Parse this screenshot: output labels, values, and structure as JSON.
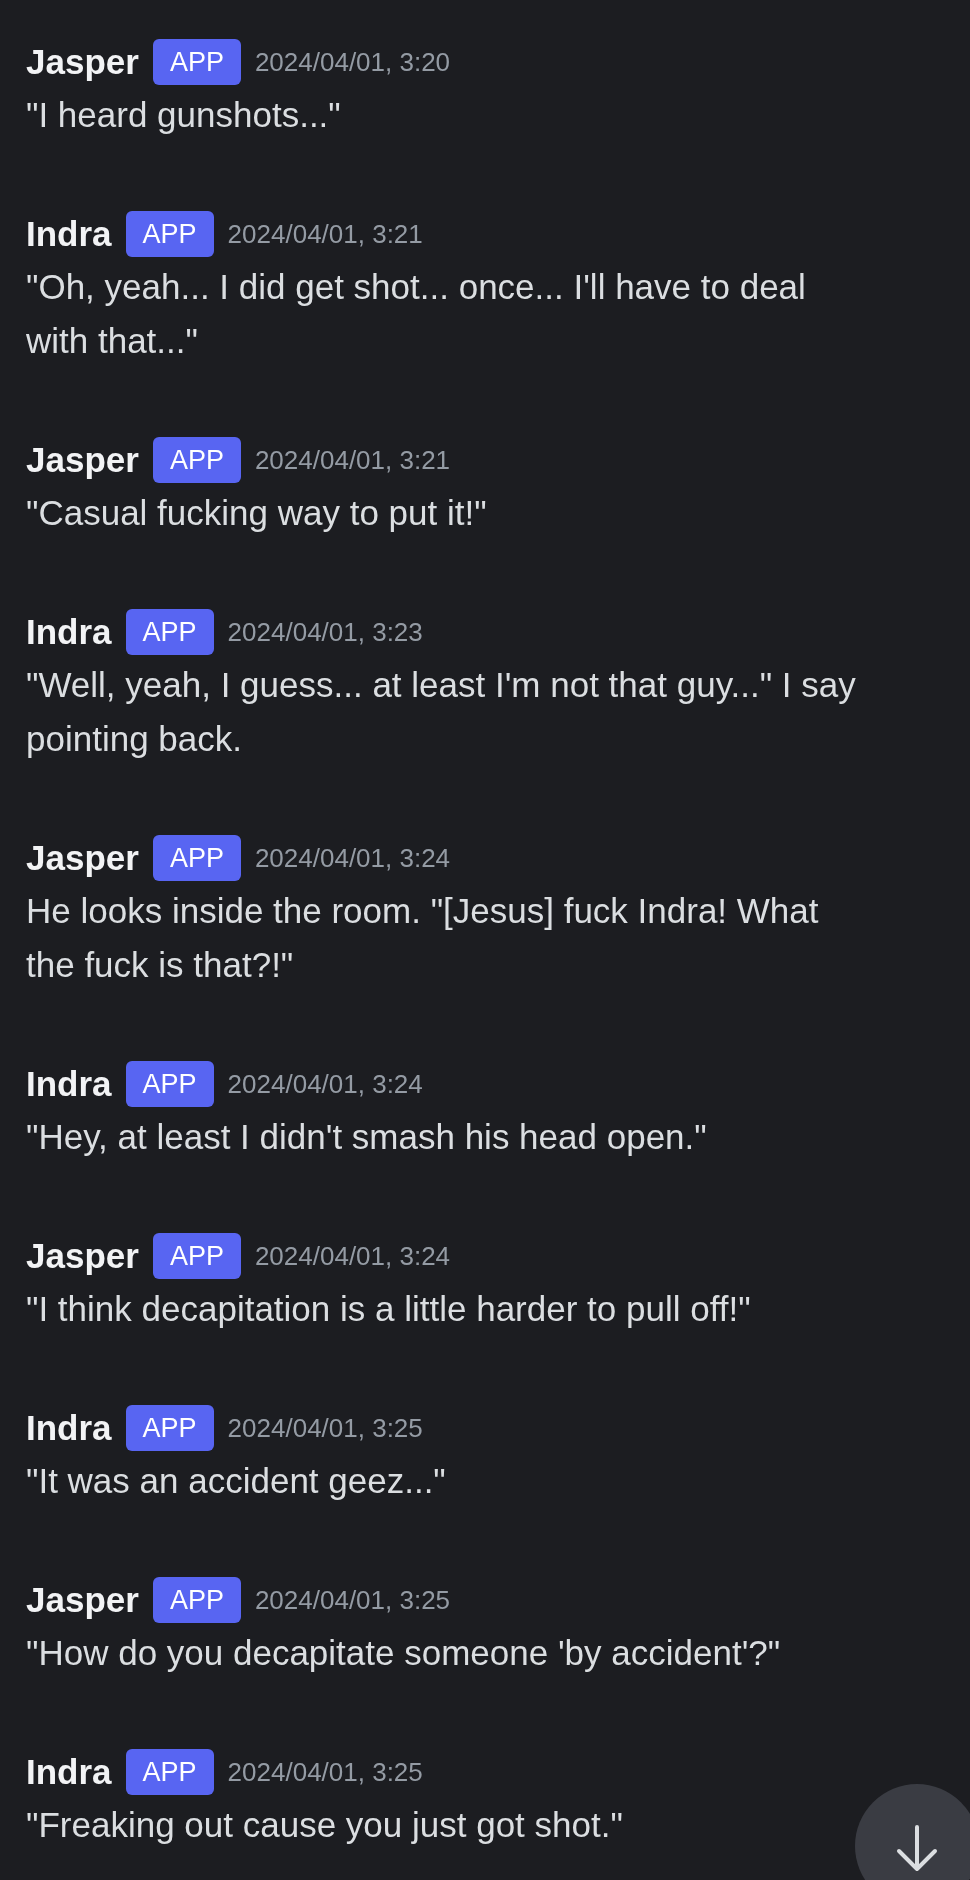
{
  "messages": [
    {
      "author": "Jasper",
      "badge": "APP",
      "time": "2024/04/01, 3:20",
      "text": "\"I heard gunshots...\""
    },
    {
      "author": "Indra",
      "badge": "APP",
      "time": "2024/04/01, 3:21",
      "text": "\"Oh, yeah... I did get shot... once... I'll have to deal with that...\""
    },
    {
      "author": "Jasper",
      "badge": "APP",
      "time": "2024/04/01, 3:21",
      "text": "\"Casual fucking way to put it!\""
    },
    {
      "author": "Indra",
      "badge": "APP",
      "time": "2024/04/01, 3:23",
      "text": "\"Well, yeah, I guess... at least I'm not that guy...\" I say pointing back."
    },
    {
      "author": "Jasper",
      "badge": "APP",
      "time": "2024/04/01, 3:24",
      "text": "He looks inside the room. \"[Jesus] fuck Indra! What the fuck is that?!\""
    },
    {
      "author": "Indra",
      "badge": "APP",
      "time": "2024/04/01, 3:24",
      "text": "\"Hey, at least I didn't smash his head open.\""
    },
    {
      "author": "Jasper",
      "badge": "APP",
      "time": "2024/04/01, 3:24",
      "text": "\"I think decapitation is a little harder to pull off!\""
    },
    {
      "author": "Indra",
      "badge": "APP",
      "time": "2024/04/01, 3:25",
      "text": "\"It was an accident geez...\""
    },
    {
      "author": "Jasper",
      "badge": "APP",
      "time": "2024/04/01, 3:25",
      "text": "\"How do you decapitate someone 'by accident'?\""
    },
    {
      "author": "Indra",
      "badge": "APP",
      "time": "2024/04/01, 3:25",
      "text": "\"Freaking out cause you just got shot.\""
    }
  ]
}
